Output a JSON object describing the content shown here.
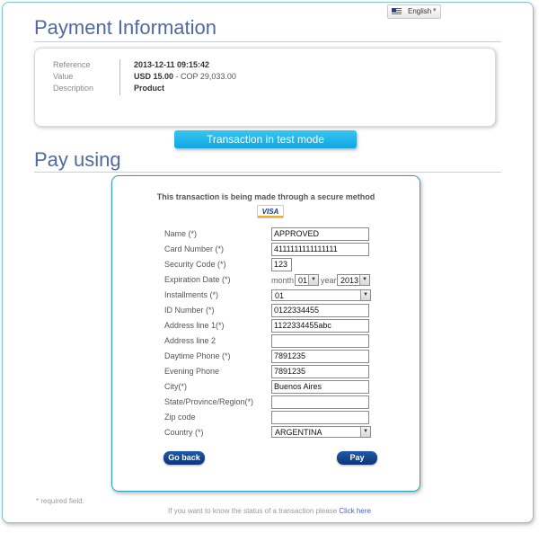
{
  "language": {
    "label": "English"
  },
  "headers": {
    "payment_info": "Payment Information",
    "pay_using": "Pay using"
  },
  "info": {
    "labels": [
      "Reference",
      "Value",
      "Description"
    ],
    "reference": "2013-12-11 09:15:42",
    "value_primary": "USD 15.00",
    "value_secondary": " - COP 29,033.00",
    "description": "Product"
  },
  "test_mode": "Transaction in test mode",
  "form": {
    "secure_text": "This transaction is being made through a secure method",
    "card_brand": "VISA",
    "labels": {
      "name": "Name (*)",
      "card_number": "Card Number (*)",
      "security_code": "Security Code (*)",
      "expiration_date": "Expiration Date (*)",
      "installments": "Installments (*)",
      "id_number": "ID Number (*)",
      "address1": "Address line 1(*)",
      "address2": "Address line 2",
      "daytime_phone": "Daytime Phone (*)",
      "evening_phone": "Evening Phone",
      "city": "City(*)",
      "state": "State/Province/Region(*)",
      "zip": "Zip code",
      "country": "Country (*)"
    },
    "values": {
      "name": "APPROVED",
      "card_number": "4111111111111111",
      "security_code": "123",
      "month_label": "month",
      "month": "01",
      "year_label": "year",
      "year": "2013",
      "installments": "01",
      "id_number": "0122334455",
      "address1": "1122334455abc",
      "address2": "",
      "daytime_phone": "7891235",
      "evening_phone": "7891235",
      "city": "Buenos Aires",
      "state": "",
      "zip": "",
      "country": "ARGENTINA"
    },
    "buttons": {
      "go_back": "Go back",
      "pay": "Pay"
    }
  },
  "footer": {
    "required_note": "* required field.",
    "status_text": "If you want to know the status of a transaction please ",
    "status_link": "Click here"
  }
}
